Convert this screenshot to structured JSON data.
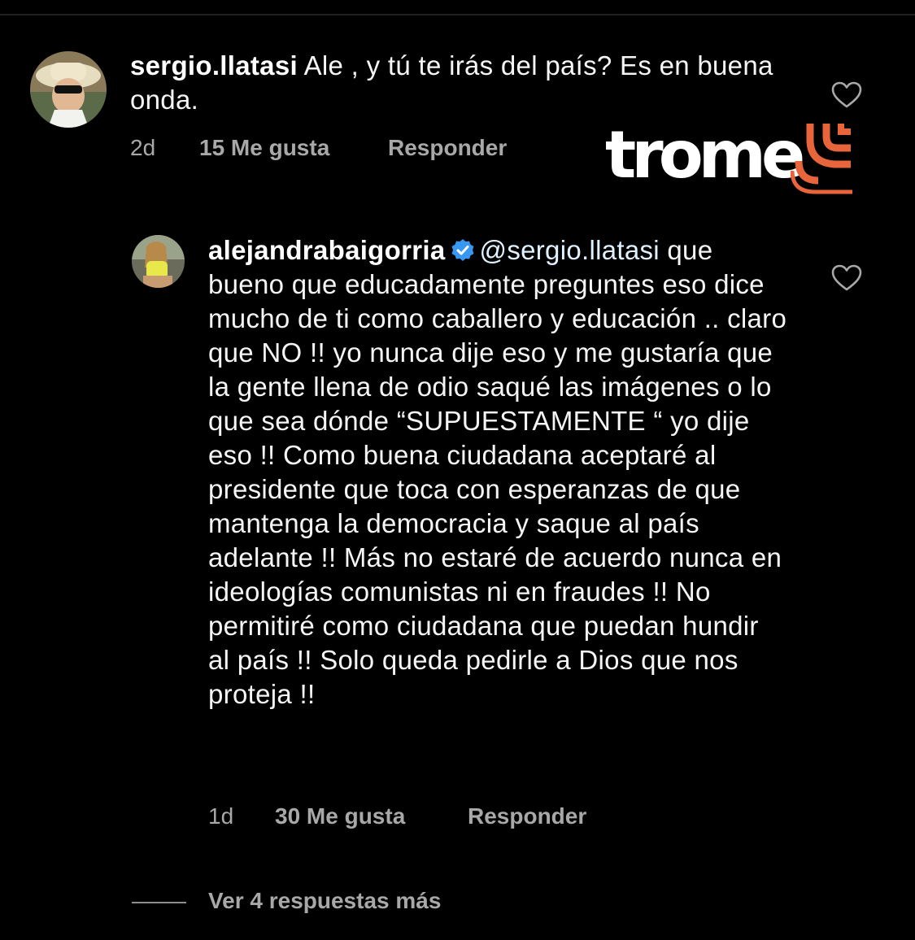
{
  "logo": {
    "text": "trome",
    "accent_color": "#e8643a"
  },
  "comments": [
    {
      "username": "sergio.llatasi",
      "text": " Ale , y tú te irás del país? Es en buena onda.",
      "time": "2d",
      "likes": "15 Me gusta",
      "reply_label": "Responder"
    },
    {
      "username": "alejandrabaigorria",
      "verified": true,
      "mention": "@sergio.llatasi",
      "text": " que bueno que educadamente preguntes eso dice mucho de ti como caballero y educación .. claro que NO !! yo nunca dije eso y me gustaría que la gente llena de odio saqué las imágenes o lo que sea dónde “SUPUESTAMENTE “ yo dije eso !! Como buena ciudadana aceptaré al presidente que toca con esperanzas de que mantenga la democracia y saque al país adelante !! Más no estaré de acuerdo nunca en ideologías comunistas ni en fraudes !! No permitiré como ciudadana que puedan hundir al país !! Solo queda pedirle a Dios que nos proteja !!",
      "time": "1d",
      "likes": "30 Me gusta",
      "reply_label": "Responder"
    }
  ],
  "view_replies": "Ver 4 respuestas más",
  "colors": {
    "background": "#000000",
    "meta_text": "#a8a8a8",
    "verified_badge": "#3897f0"
  }
}
